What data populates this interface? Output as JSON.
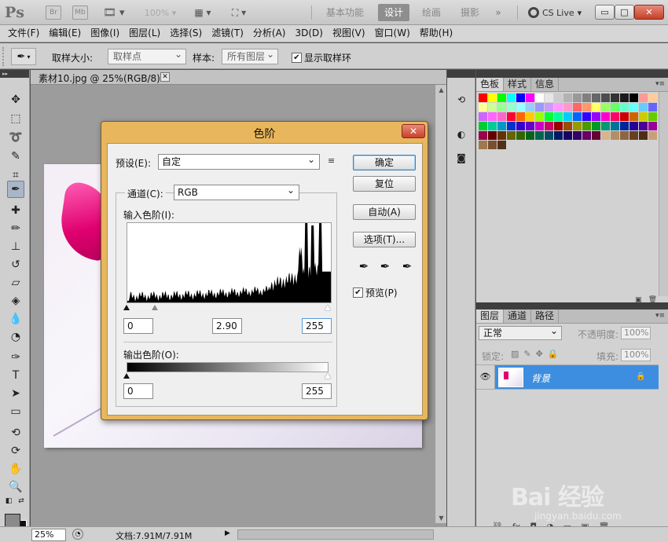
{
  "app": {
    "logo": "Ps",
    "bridge": "Br",
    "minibridge": "Mb",
    "zoom": "100%",
    "workspaces": [
      "基本功能",
      "设计",
      "绘画",
      "摄影",
      "»"
    ],
    "active_workspace": "设计",
    "cs_live": "CS Live",
    "window_controls": {
      "minimize": "▭",
      "maximize": "□",
      "close": "✕"
    }
  },
  "menus": [
    "文件(F)",
    "编辑(E)",
    "图像(I)",
    "图层(L)",
    "选择(S)",
    "滤镜(T)",
    "分析(A)",
    "3D(D)",
    "视图(V)",
    "窗口(W)",
    "帮助(H)"
  ],
  "options": {
    "sample_size_label": "取样大小:",
    "sample_size_value": "取样点",
    "sample_label": "样本:",
    "sample_value": "所有图层",
    "show_ring_label": "显示取样环",
    "show_ring_checked": "✔"
  },
  "document": {
    "tab_title": "素材10.jpg @ 25%(RGB/8) *",
    "tab_close": "✕"
  },
  "status": {
    "zoom": "25%",
    "doc_size": "文档:7.91M/7.91M",
    "arrow": "▶"
  },
  "panels": {
    "swatch_tabs": [
      "色板",
      "样式",
      "信息"
    ],
    "layer_tabs": [
      "图层",
      "通道",
      "路径"
    ],
    "blend_mode": "正常",
    "opacity_label": "不透明度:",
    "opacity_value": "100%",
    "lock_label": "锁定:",
    "fill_label": "填充:",
    "fill_value": "100%",
    "layer_name": "背景",
    "swatch_colors": [
      "#ff0000",
      "#ffff00",
      "#00ff00",
      "#00ffff",
      "#0000ff",
      "#ff00ff",
      "#ffffff",
      "#e6e6e6",
      "#cccccc",
      "#b3b3b3",
      "#999999",
      "#808080",
      "#666666",
      "#4d4d4d",
      "#333333",
      "#1a1a1a",
      "#000000",
      "#ff9999",
      "#ffcc99",
      "#ffff99",
      "#ccff99",
      "#99ff99",
      "#99ffcc",
      "#99ffff",
      "#99ccff",
      "#9999ff",
      "#cc99ff",
      "#ff99ff",
      "#ff99cc",
      "#ff6666",
      "#ff9966",
      "#ffff66",
      "#99ff66",
      "#66ff66",
      "#66ffcc",
      "#66ffff",
      "#66ccff",
      "#6666ff",
      "#cc66ff",
      "#ff66ff",
      "#ff66cc",
      "#ff0033",
      "#ff6600",
      "#ffcc00",
      "#99ff00",
      "#00ff33",
      "#00ff99",
      "#00ccff",
      "#0066ff",
      "#3300ff",
      "#9900ff",
      "#ff00cc",
      "#ff0066",
      "#cc0000",
      "#cc6600",
      "#cccc00",
      "#66cc00",
      "#00cc33",
      "#00cc99",
      "#0099cc",
      "#0033cc",
      "#3300cc",
      "#6600cc",
      "#cc00cc",
      "#cc0066",
      "#990000",
      "#994d00",
      "#999900",
      "#4d9900",
      "#009926",
      "#009973",
      "#007399",
      "#002699",
      "#260099",
      "#4d0099",
      "#990099",
      "#99004d",
      "#660000",
      "#663300",
      "#666600",
      "#336600",
      "#00661a",
      "#00664d",
      "#004d66",
      "#001a66",
      "#1a0066",
      "#330066",
      "#660066",
      "#660033",
      "#d9b38c",
      "#b38f66",
      "#8c6640",
      "#664020",
      "#4d2e14",
      "#c8a078",
      "#a07850",
      "#785030",
      "#503018"
    ]
  },
  "levels": {
    "title": "色阶",
    "close": "✕",
    "preset_label": "预设(E):",
    "preset_value": "自定",
    "preset_menu": "≡",
    "channel_label": "通道(C):",
    "channel_value": "RGB",
    "input_label": "输入色阶(I):",
    "output_label": "输出色阶(O):",
    "input_black": "0",
    "input_gamma": "2.90",
    "input_white": "255",
    "output_black": "0",
    "output_white": "255",
    "buttons": {
      "ok": "确定",
      "reset": "复位",
      "auto": "自动(A)",
      "options": "选项(T)..."
    },
    "preview_label": "预览(P)",
    "preview_checked": "✔"
  },
  "watermark": {
    "brand": "Bai 经验",
    "url": "jingyan.baidu.com"
  }
}
